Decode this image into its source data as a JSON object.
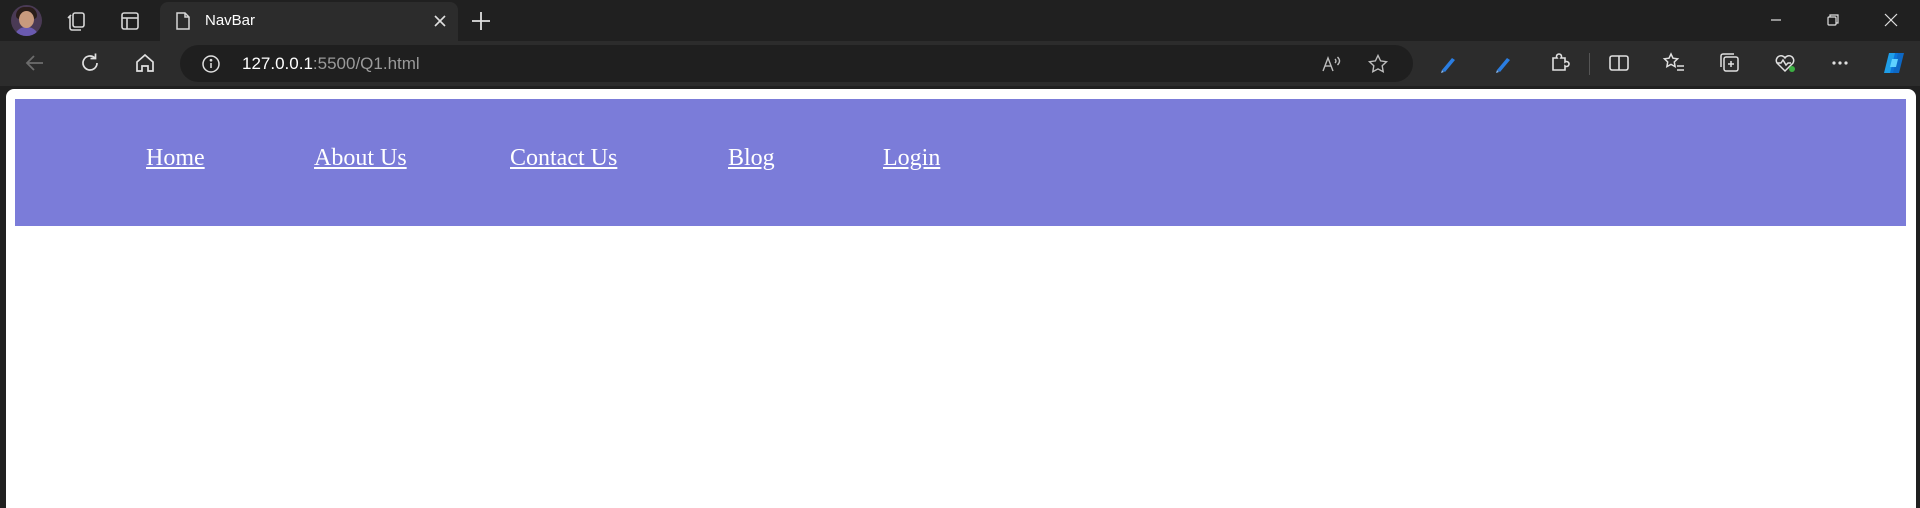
{
  "browser": {
    "tab": {
      "title": "NavBar"
    },
    "address_bar": {
      "url_host": "127.0.0.1",
      "url_rest": ":5500/Q1.html"
    },
    "icons": {
      "profile": "profile-avatar",
      "workspaces": "workspaces-icon",
      "tab_actions": "tab-actions-icon",
      "page": "page-icon",
      "close": "close-icon",
      "new_tab": "plus-icon",
      "back": "back-arrow-icon",
      "refresh": "refresh-icon",
      "home": "home-icon",
      "info": "info-icon",
      "read_aloud": "read-aloud-icon",
      "favorite": "star-icon",
      "extensions": "puzzle-icon",
      "split_screen": "split-screen-icon",
      "favorites": "favorites-icon",
      "collections": "collections-icon",
      "health": "browser-essentials-icon",
      "more": "more-icon",
      "copilot": "copilot-icon"
    }
  },
  "page": {
    "navbar": {
      "background": "#7b7cd9",
      "links": [
        {
          "label": "Home"
        },
        {
          "label": "About Us"
        },
        {
          "label": "Contact Us"
        },
        {
          "label": "Blog"
        },
        {
          "label": "Login"
        }
      ]
    }
  }
}
